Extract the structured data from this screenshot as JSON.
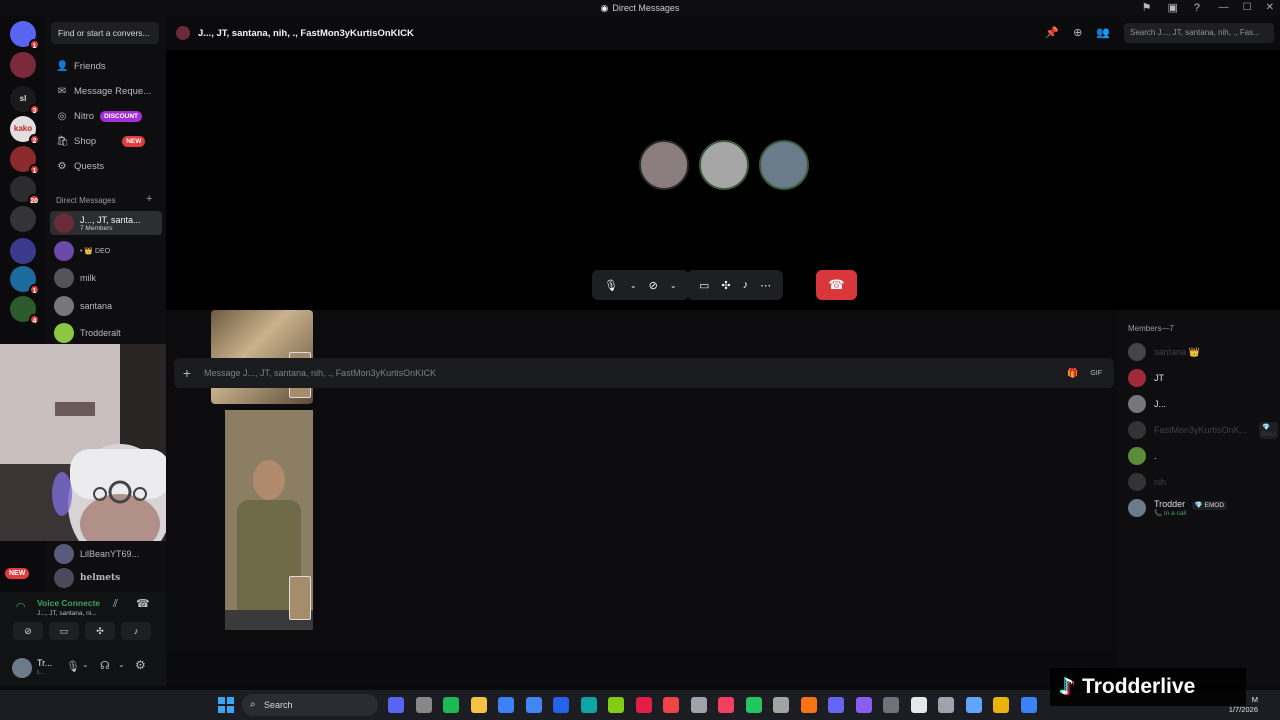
{
  "window": {
    "title": "Direct Messages",
    "controls": [
      "—",
      "☐",
      "✕"
    ]
  },
  "rail": {
    "servers": [
      {
        "name": "discord-home",
        "color": "#5865f2",
        "badge": "1"
      },
      {
        "name": "server-1",
        "color": "#7a2a3a",
        "badge": ""
      },
      {
        "name": "server-sl",
        "color": "#1a1a1d",
        "text": "sl",
        "badge": "3"
      },
      {
        "name": "server-kako",
        "color": "#e0e0e0",
        "text": "kako",
        "badge": "2"
      },
      {
        "name": "server-4",
        "color": "#8a2a2a",
        "badge": "1"
      },
      {
        "name": "server-5",
        "color": "#2c2c30",
        "badge": "20"
      },
      {
        "name": "server-6",
        "color": "#333338",
        "badge": ""
      },
      {
        "name": "server-spy",
        "color": "#3a3a8a",
        "badge": ""
      },
      {
        "name": "server-8",
        "color": "#1c6b9c",
        "badge": "1"
      },
      {
        "name": "server-9",
        "color": "#2d5a2d",
        "badge": "4"
      }
    ],
    "new_label": "NEW"
  },
  "sidebar": {
    "find_placeholder": "Find or start a convers...",
    "nav": [
      {
        "label": "Friends",
        "icon": "👤"
      },
      {
        "label": "Message Reque...",
        "icon": "✉"
      },
      {
        "label": "Nitro",
        "icon": "◎",
        "pill": "DISCOUNT",
        "pill_color": "#a32fd6"
      },
      {
        "label": "Shop",
        "icon": "🛍",
        "pill": "NEW",
        "pill_color": "#e23c3f"
      },
      {
        "label": "Quests",
        "icon": "⚙"
      }
    ],
    "dm_header": "Direct Messages",
    "dms": [
      {
        "name": "J..., JT, santa...",
        "sub": "7 Members",
        "active": true,
        "color": "#6b2a3a"
      },
      {
        "name": "• 👑 DEO",
        "sub": "",
        "color": "#6a4aa8"
      },
      {
        "name": "milk",
        "sub": "",
        "color": "#555"
      },
      {
        "name": "santana",
        "sub": "",
        "color": "#777"
      },
      {
        "name": "Trodderalt",
        "sub": "",
        "color": "#8dc63f"
      },
      {
        "name": "LilBeanYT69...",
        "sub": "",
        "color": "#5a5a7a"
      },
      {
        "name": "helmets",
        "sub": "",
        "color": "#4a4a5a"
      }
    ],
    "voice": {
      "status": "Voice Connecte",
      "channel": "J..., JT, santana, ni..."
    },
    "user": {
      "name": "Tr...",
      "status": "I..."
    }
  },
  "header": {
    "channel_title": "J..., JT, santana, nih, ., FastMon3yKurtisOnKICK",
    "search_placeholder": "Search J..., JT, santana, nih, ., Fas..."
  },
  "call": {
    "participants": [
      {
        "name": "participant-1",
        "color": "#8a7d7d"
      },
      {
        "name": "participant-2",
        "color": "#a6a6a6"
      },
      {
        "name": "participant-3",
        "color": "#6c7b8a"
      }
    ]
  },
  "composer": {
    "placeholder": "Message J..., JT, santana, nih, ., FastMon3yKurtisOnKICK"
  },
  "members": {
    "header": "Members—7",
    "list": [
      {
        "name": "santana 👑",
        "dim": true,
        "color": "#444"
      },
      {
        "name": "JT",
        "dim": false,
        "color": "#a02a3a"
      },
      {
        "name": "J...",
        "dim": false,
        "color": "#777"
      },
      {
        "name": "FastMon3yKurtisOnK...",
        "tag": "💎 BAU",
        "dim": true,
        "color": "#333"
      },
      {
        "name": ".",
        "dim": false,
        "color": "#5b8c3a"
      },
      {
        "name": "nih",
        "dim": true,
        "color": "#333"
      },
      {
        "name": "Trodder",
        "tag": "💎 EMOD",
        "sub": "📞 In a call",
        "dim": false,
        "color": "#6c7b8a"
      }
    ]
  },
  "taskbar": {
    "search_label": "Search",
    "time": "M",
    "date": "1/7/2026"
  },
  "watermark": {
    "label": "Trodderlive"
  }
}
